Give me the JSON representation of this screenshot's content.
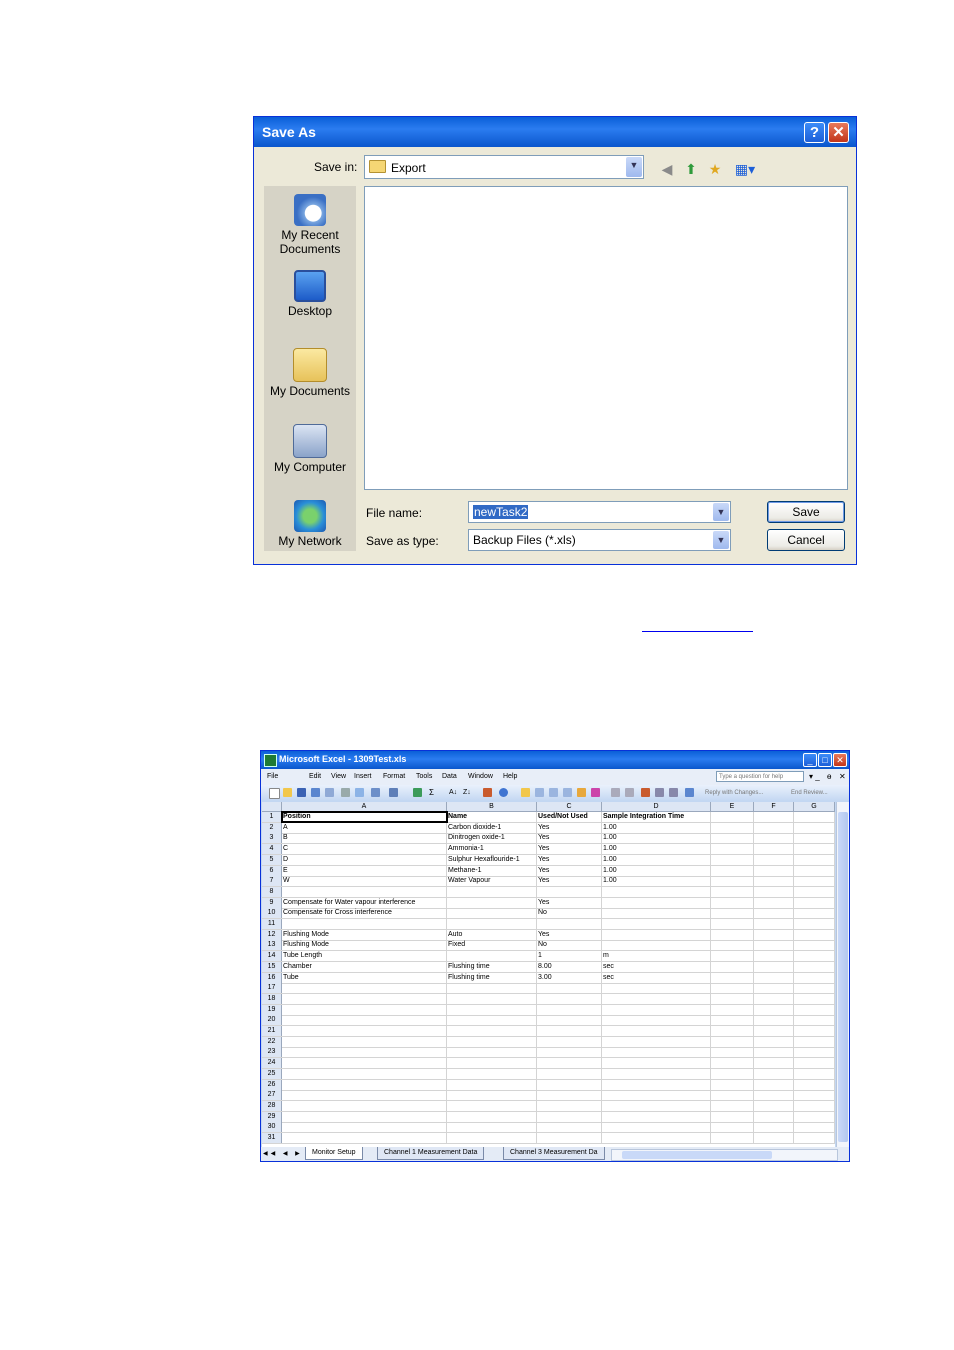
{
  "dialog": {
    "title": "Save As",
    "help_btn": "?",
    "close_btn": "✕",
    "save_in_label": "Save in:",
    "save_in_value": "Export",
    "places": [
      "My Recent Documents",
      "Desktop",
      "My Documents",
      "My Computer",
      "My Network"
    ],
    "file_name_label": "File name:",
    "file_name_value": "newTask2",
    "save_as_type_label": "Save as type:",
    "save_as_type_value": "Backup  Files (*.xls)",
    "save_button": "Save",
    "cancel_button": "Cancel"
  },
  "excel": {
    "title": "Microsoft Excel - 1309Test.xls",
    "menu": [
      "File",
      "Edit",
      "View",
      "Insert",
      "Format",
      "Tools",
      "Data",
      "Window",
      "Help"
    ],
    "help_placeholder": "Type a question for help",
    "toolbar_text": [
      "Reply with Changes...",
      "End Review..."
    ],
    "columns": [
      "A",
      "B",
      "C",
      "D",
      "E",
      "F",
      "G"
    ],
    "rows": [
      [
        "Position",
        "Name",
        "Used/Not Used",
        "Sample Integration Time"
      ],
      [
        "A",
        "Carbon dioxide-1",
        "Yes",
        "1.00"
      ],
      [
        "B",
        "Dinitrogen oxide-1",
        "Yes",
        "1.00"
      ],
      [
        "C",
        "Ammonia-1",
        "Yes",
        "1.00"
      ],
      [
        "D",
        "Sulphur Hexaflouride-1",
        "Yes",
        "1.00"
      ],
      [
        "E",
        "Methane-1",
        "Yes",
        "1.00"
      ],
      [
        "W",
        "Water Vapour",
        "Yes",
        "1.00"
      ],
      [
        "",
        "",
        "",
        ""
      ],
      [
        "Compensate for Water vapour interference",
        "",
        "Yes",
        ""
      ],
      [
        "Compensate for Cross interference",
        "",
        "No",
        ""
      ],
      [
        "",
        "",
        "",
        ""
      ],
      [
        "Flushing Mode",
        "Auto",
        "Yes",
        ""
      ],
      [
        "Flushing Mode",
        "Fixed",
        "No",
        ""
      ],
      [
        "Tube Length",
        "",
        "1",
        "m"
      ],
      [
        "Chamber",
        "Flushing time",
        "8.00",
        "sec"
      ],
      [
        "Tube",
        "Flushing time",
        "3.00",
        "sec"
      ]
    ],
    "total_rows": 31,
    "sheet_tabs": [
      "Monitor Setup",
      "Channel 1 Measurement Data",
      "Channel 3 Measurement Da"
    ]
  }
}
